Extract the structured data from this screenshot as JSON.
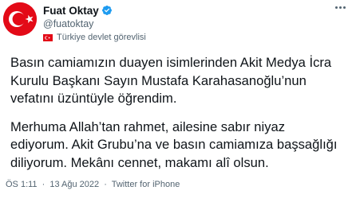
{
  "author": {
    "display_name": "Fuat Oktay",
    "handle": "@fuatoktay",
    "affiliation_label": "Türkiye devlet görevlisi",
    "verified_icon": "verified-badge-icon",
    "flag_icon": "turkey-flag-icon"
  },
  "tweet": {
    "paragraph1_lines": [
      "Basın camiamızın duayen isimlerinden Akit Medya İcra",
      "Kurulu Başkanı Sayın Mustafa Karahasanoğlu’nun",
      "vefatını üzüntüyle öğrendim."
    ],
    "paragraph2_lines": [
      "Merhuma Allah’tan rahmet, ailesine sabır niyaz",
      "ediyorum. Akit Grubu’na ve basın camiamıza başsağlığı",
      "diliyorum. Mekânı cennet, makamı alî olsun."
    ]
  },
  "meta": {
    "time": "ÖS 1:11",
    "date": "13 Ağu 2022",
    "separator": "·",
    "source": "Twitter for iPhone"
  },
  "colors": {
    "text": "#0f1419",
    "secondary": "#536471",
    "verified": "#1d9bf0",
    "flag_red": "#e30a17"
  }
}
